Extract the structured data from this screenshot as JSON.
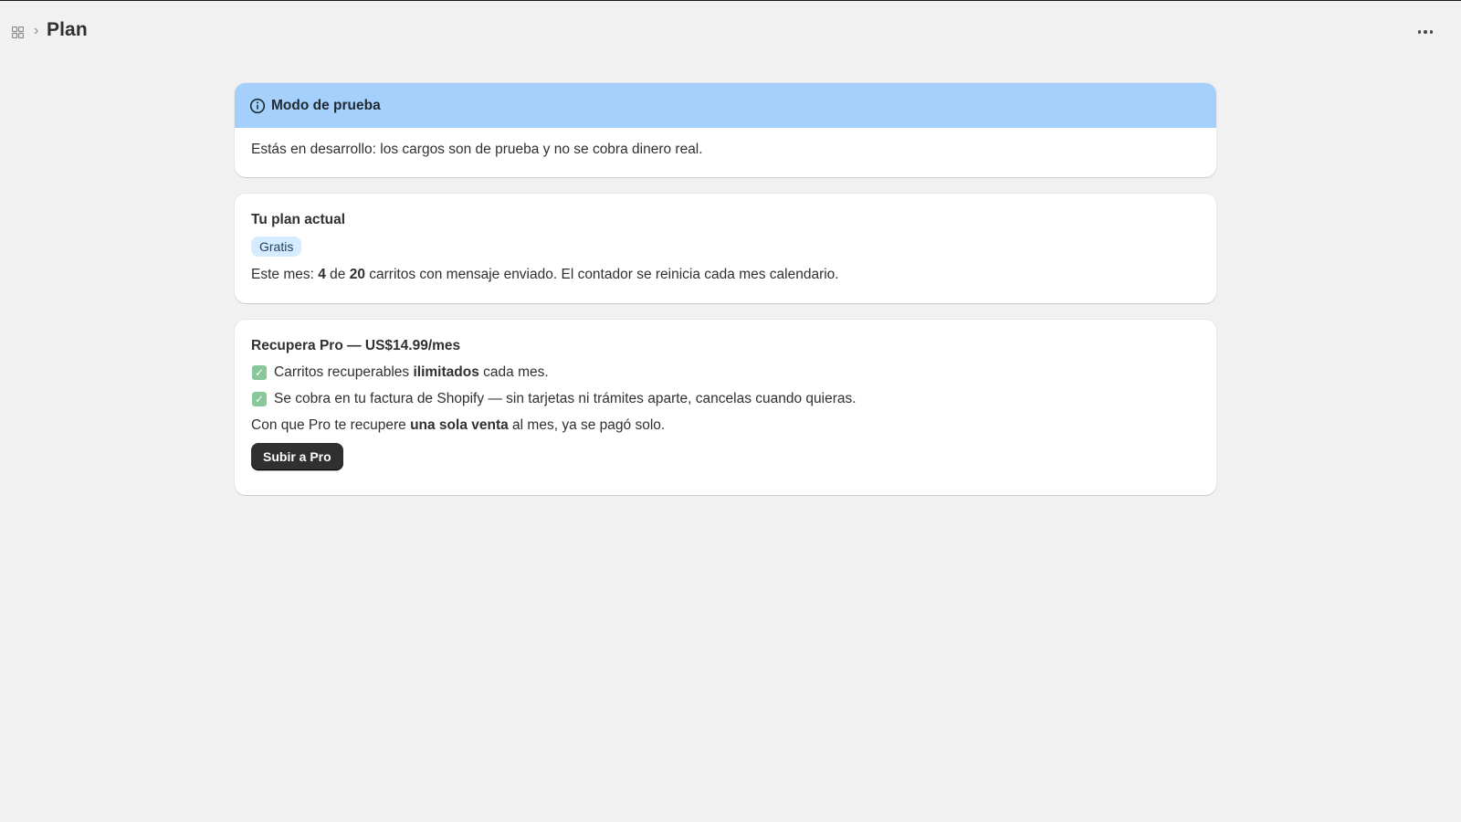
{
  "header": {
    "app_icon": "apps-grid-icon",
    "chevron": "›",
    "title": "Plan",
    "more_icon": "more-horizontal-icon"
  },
  "test_banner": {
    "icon": "info-icon",
    "title": "Modo de prueba",
    "message": "Estás en desarrollo: los cargos son de prueba y no se cobra dinero real.",
    "color": "#a4d0fb"
  },
  "current_plan": {
    "heading": "Tu plan actual",
    "badge": "Gratis",
    "usage_prefix": "Este mes: ",
    "usage_used": "4",
    "usage_of": " de ",
    "usage_limit": "20",
    "usage_suffix": " carritos con mensaje enviado. El contador se reinicia cada mes calendario."
  },
  "pro_offer": {
    "heading": "Recupera Pro — US$14.99/mes",
    "features": [
      {
        "icon": "check-icon",
        "before": "Carritos recuperables ",
        "bold": "ilimitados",
        "after": " cada mes."
      },
      {
        "icon": "check-icon",
        "before": "Se cobra en tu factura de Shopify — sin tarjetas ni trámites aparte, cancelas cuando quieras.",
        "bold": "",
        "after": ""
      }
    ],
    "pitch_before": "Con que Pro te recupere ",
    "pitch_bold": "una sola venta",
    "pitch_after": " al mes, ya se pagó solo.",
    "button_label": "Subir a Pro"
  },
  "colors": {
    "background": "#f1f1f1",
    "badge": "#d5ebff",
    "primary_button": "#303030",
    "check": "#87c79a"
  }
}
